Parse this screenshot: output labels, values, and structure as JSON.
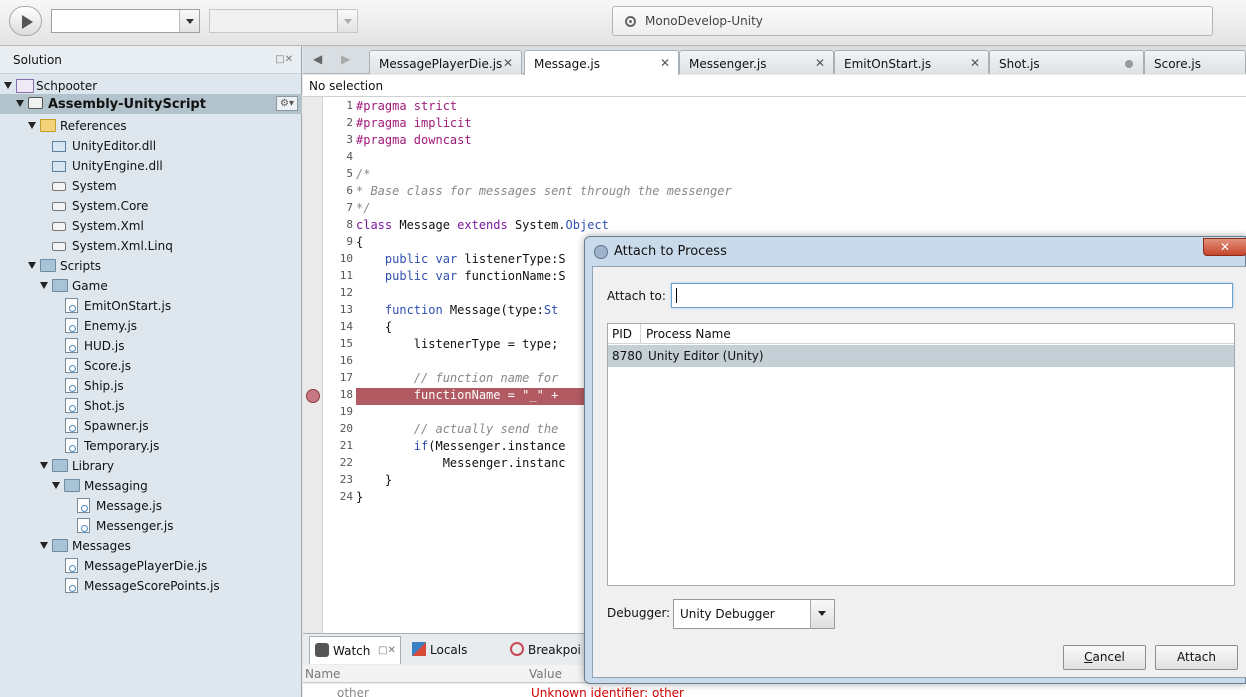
{
  "toolbar": {
    "run_icon": "play-icon",
    "config_combo_value": "",
    "target_combo_value": "",
    "status_icon": "status-ring-icon",
    "status_text": "MonoDevelop-Unity"
  },
  "solution_pad": {
    "title": "Solution",
    "controls": "□✕",
    "items": [
      {
        "label": "Schpooter",
        "icon": "solution-icon"
      },
      {
        "label": "Assembly-UnityScript",
        "icon": "project-icon",
        "selected": true
      },
      {
        "label": "References",
        "icon": "folder-icon"
      },
      {
        "label": "UnityEditor.dll",
        "icon": "dll-reference-icon"
      },
      {
        "label": "UnityEngine.dll",
        "icon": "dll-reference-icon"
      },
      {
        "label": "System",
        "icon": "reference-icon"
      },
      {
        "label": "System.Core",
        "icon": "reference-icon"
      },
      {
        "label": "System.Xml",
        "icon": "reference-icon"
      },
      {
        "label": "System.Xml.Linq",
        "icon": "reference-icon"
      },
      {
        "label": "Scripts",
        "icon": "folder-icon"
      },
      {
        "label": "Game",
        "icon": "folder-icon"
      },
      {
        "label": "EmitOnStart.js",
        "icon": "file-icon"
      },
      {
        "label": "Enemy.js",
        "icon": "file-icon"
      },
      {
        "label": "HUD.js",
        "icon": "file-icon"
      },
      {
        "label": "Score.js",
        "icon": "file-icon"
      },
      {
        "label": "Ship.js",
        "icon": "file-icon"
      },
      {
        "label": "Shot.js",
        "icon": "file-icon"
      },
      {
        "label": "Spawner.js",
        "icon": "file-icon"
      },
      {
        "label": "Temporary.js",
        "icon": "file-icon"
      },
      {
        "label": "Library",
        "icon": "folder-icon"
      },
      {
        "label": "Messaging",
        "icon": "folder-icon"
      },
      {
        "label": "Message.js",
        "icon": "file-icon"
      },
      {
        "label": "Messenger.js",
        "icon": "file-icon"
      },
      {
        "label": "Messages",
        "icon": "folder-icon"
      },
      {
        "label": "MessagePlayerDie.js",
        "icon": "file-icon"
      },
      {
        "label": "MessageScorePoints.js",
        "icon": "file-icon"
      }
    ]
  },
  "editor": {
    "tabs": [
      {
        "label": "MessagePlayerDie.js",
        "close": "✕"
      },
      {
        "label": "Message.js",
        "close": "✕",
        "active": true
      },
      {
        "label": "Messenger.js",
        "close": "✕"
      },
      {
        "label": "EmitOnStart.js",
        "close": "✕"
      },
      {
        "label": "Shot.js",
        "close": "modified-dot-icon"
      },
      {
        "label": "Score.js",
        "close": ""
      }
    ],
    "nav_left": "◀",
    "nav_right": "▶",
    "selection_label": "No selection",
    "line_numbers": [
      "1",
      "2",
      "3",
      "4",
      "5",
      "6",
      "7",
      "8",
      "9",
      "10",
      "11",
      "12",
      "13",
      "14",
      "15",
      "16",
      "17",
      "18",
      "19",
      "20",
      "21",
      "22",
      "23",
      "24"
    ],
    "breakpoint_line": "18",
    "code": {
      "l1a": "#pragma",
      "l1b": " strict",
      "l2a": "#pragma",
      "l2b": " implicit",
      "l3a": "#pragma",
      "l3b": " downcast",
      "l5": "/*",
      "l6": "* Base class for messages sent through the messenger",
      "l7": "*/",
      "l8a": "class",
      "l8b": " Message ",
      "l8c": "extends",
      "l8d": " System.",
      "l8e": "Object",
      "l9": "{",
      "l10a": "    ",
      "l10b": "public",
      "l10c": " ",
      "l10d": "var",
      "l10e": " listenerType:S",
      "l11a": "    ",
      "l11b": "public",
      "l11c": " ",
      "l11d": "var",
      "l11e": " functionName:S",
      "l13a": "    ",
      "l13b": "function",
      "l13c": " Message(type:",
      "l13d": "St",
      "l14": "    {",
      "l15": "        listenerType = type;",
      "l17": "        // function name for",
      "l18": "        functionName = \"_\" + ",
      "l20": "        // actually send the",
      "l21a": "        ",
      "l21b": "if",
      "l21c": "(Messenger.instance",
      "l22": "            Messenger.instanc",
      "l23": "    }",
      "l24": "}"
    }
  },
  "watch_pad": {
    "tabs": [
      {
        "label": "Watch",
        "icon": "binoculars-icon",
        "active": true
      },
      {
        "label": "Locals",
        "icon": "locals-icon"
      },
      {
        "label": "Breakpoi",
        "icon": "breakpoint-icon"
      }
    ],
    "tab_controls": "□✕",
    "columns": [
      "Name",
      "Value"
    ],
    "row": {
      "name": "other",
      "value": "Unknown identifier: other"
    }
  },
  "dialog": {
    "title": "Attach to Process",
    "close_label": "✕",
    "attach_to_label": "Attach to:",
    "attach_to_value": "",
    "columns": [
      "PID",
      "Process Name"
    ],
    "processes": [
      {
        "pid": "8780",
        "name": "Unity Editor (Unity)"
      }
    ],
    "debugger_label": "Debugger:",
    "debugger_value": "Unity Debugger",
    "cancel_label_first": "C",
    "cancel_label_rest": "ancel",
    "attach_label": "Attach"
  }
}
